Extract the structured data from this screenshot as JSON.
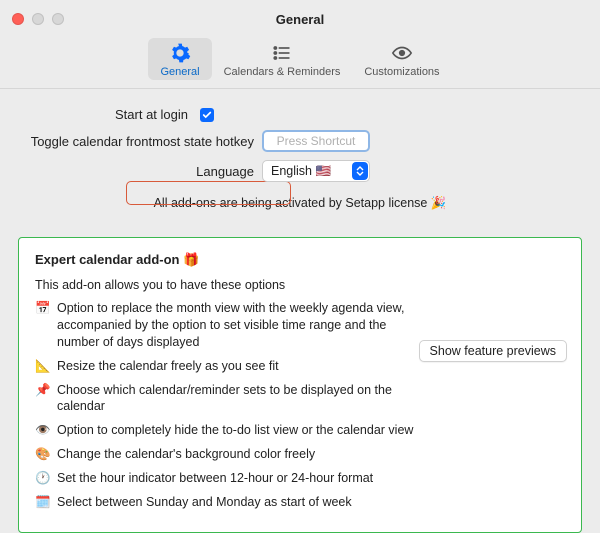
{
  "window": {
    "title": "General"
  },
  "tabs": {
    "general": "General",
    "calrem": "Calendars & Reminders",
    "custom": "Customizations"
  },
  "form": {
    "start_label": "Start at login",
    "hotkey_label": "Toggle calendar frontmost state hotkey",
    "hotkey_placeholder": "Press Shortcut",
    "language_label": "Language",
    "language_value": "English 🇺🇸"
  },
  "activation": "All add-ons are being activated by Setapp license 🎉",
  "addon": {
    "title": "Expert calendar add-on 🎁",
    "intro": "This add-on allows you to have these options",
    "preview_button": "Show feature previews",
    "features": [
      {
        "emoji": "📅",
        "text": "Option to replace the month view with the weekly agenda view, accompanied by the option to set visible time range and the number of days displayed"
      },
      {
        "emoji": "📐",
        "text": "Resize the calendar freely as you see fit"
      },
      {
        "emoji": "📌",
        "text": "Choose which calendar/reminder sets to be displayed on the calendar"
      },
      {
        "emoji": "👁️",
        "text": "Option to completely hide the to-do list view or the calendar view"
      },
      {
        "emoji": "🎨",
        "text": "Change the calendar's background color freely"
      },
      {
        "emoji": "🕐",
        "text": "Set the hour indicator between 12-hour or 24-hour format"
      },
      {
        "emoji": "🗓️",
        "text": "Select between Sunday and Monday as start of week"
      }
    ]
  }
}
